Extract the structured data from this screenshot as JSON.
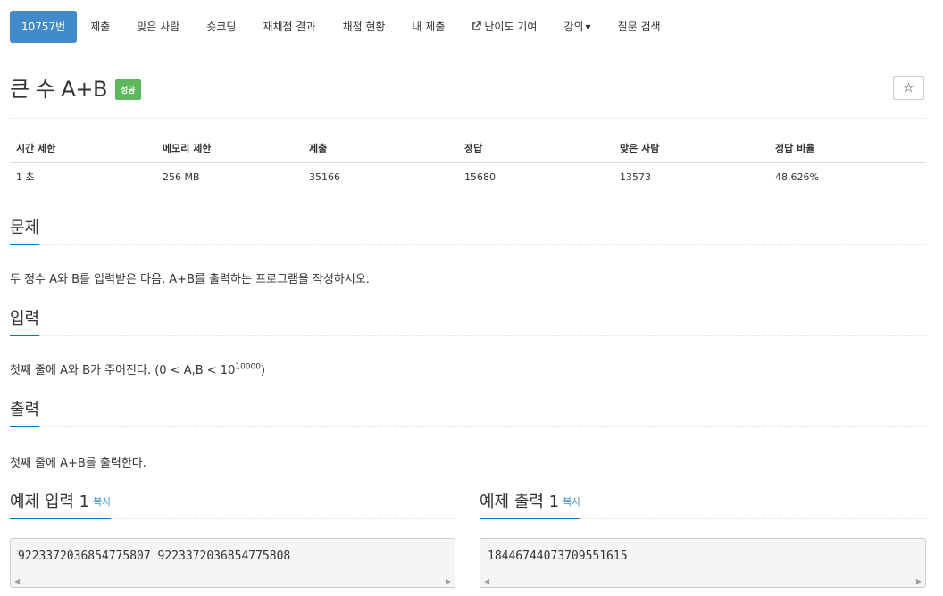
{
  "tabs": [
    {
      "label": "10757번",
      "active": true
    },
    {
      "label": "제출"
    },
    {
      "label": "맞은 사람"
    },
    {
      "label": "숏코딩"
    },
    {
      "label": "재채점 결과"
    },
    {
      "label": "채점 현황"
    },
    {
      "label": "내 제출"
    },
    {
      "label": "난이도 기여",
      "icon": "external-link-icon"
    },
    {
      "label": "강의",
      "icon": "caret-down-icon"
    },
    {
      "label": "질문 검색"
    }
  ],
  "problem": {
    "title": "큰 수 A+B",
    "badge": "성공",
    "star_icon": "☆"
  },
  "stats": {
    "headers": [
      "시간 제한",
      "메모리 제한",
      "제출",
      "정답",
      "맞은 사람",
      "정답 비율"
    ],
    "values": [
      "1 초",
      "256 MB",
      "35166",
      "15680",
      "13573",
      "48.626%"
    ]
  },
  "sections": {
    "problem": {
      "title": "문제",
      "text": "두 정수 A와 B를 입력받은 다음, A+B를 출력하는 프로그램을 작성하시오."
    },
    "input": {
      "title": "입력",
      "text_before": "첫째 줄에 A와 B가 주어진다. (0 < A,B < 10",
      "superscript": "10000",
      "text_after": ")"
    },
    "output": {
      "title": "출력",
      "text": "첫째 줄에 A+B를 출력한다."
    }
  },
  "samples": {
    "input": {
      "title": "예제 입력 1",
      "copy": "복사",
      "content": "9223372036854775807 9223372036854775808"
    },
    "output": {
      "title": "예제 출력 1",
      "copy": "복사",
      "content": "18446744073709551615"
    }
  },
  "colors": {
    "accent": "#428bca",
    "success": "#5cb85c",
    "underline": "#0076c0"
  }
}
